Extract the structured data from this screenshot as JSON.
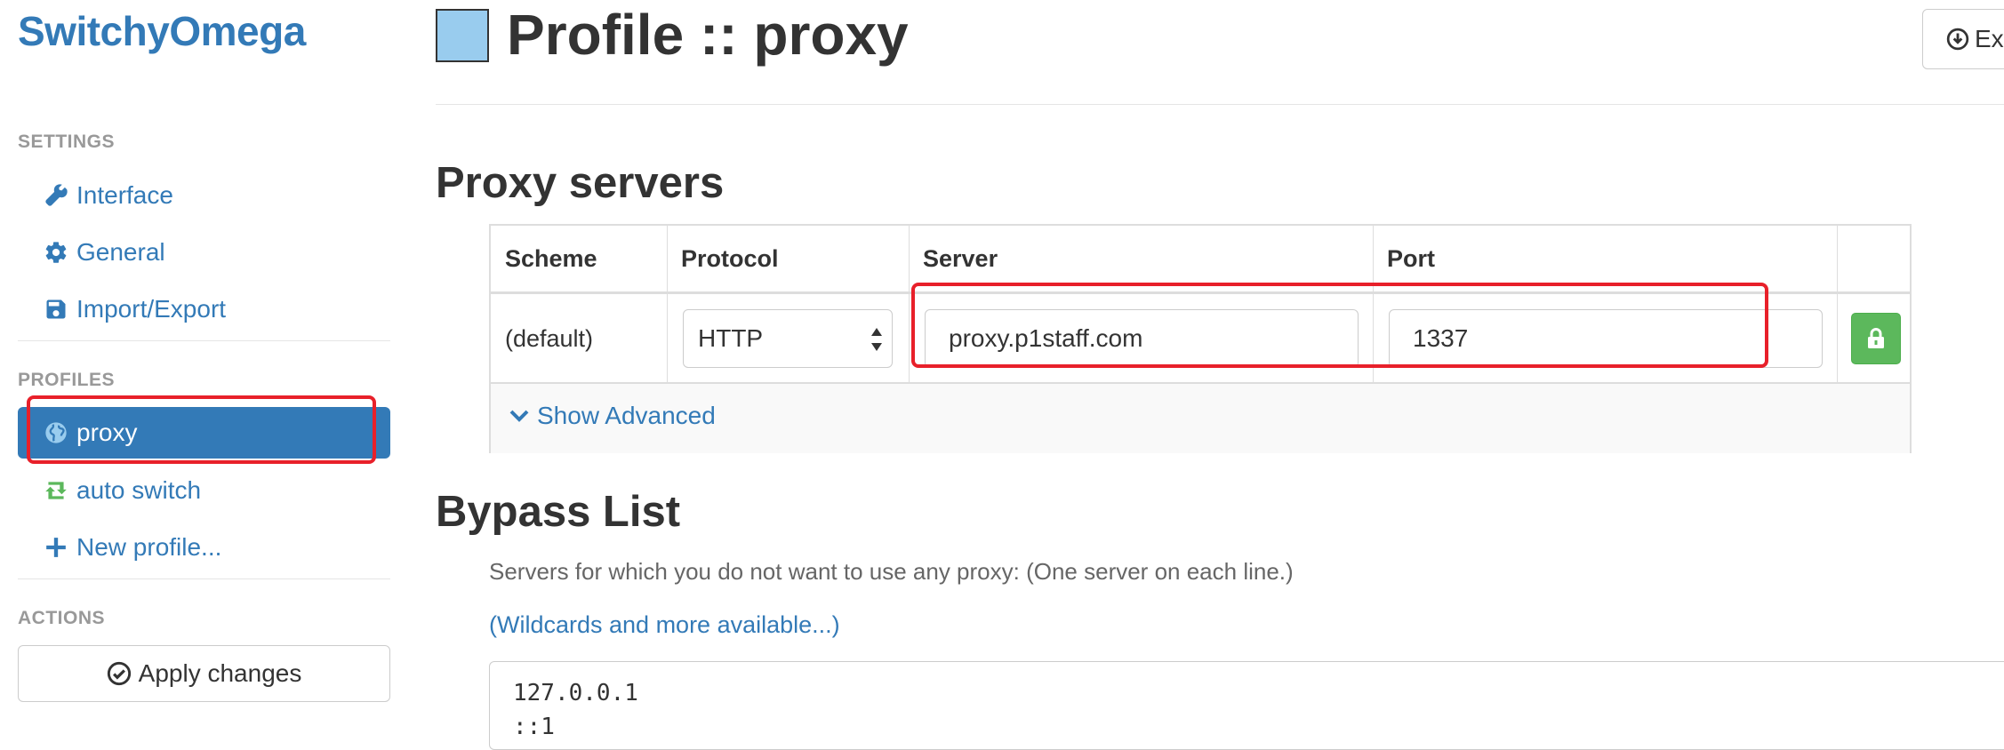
{
  "app": {
    "brand": "SwitchyOmega"
  },
  "sidebar": {
    "settings_header": "SETTINGS",
    "settings_items": [
      {
        "label": "Interface",
        "icon": "wrench-icon"
      },
      {
        "label": "General",
        "icon": "gear-icon"
      },
      {
        "label": "Import/Export",
        "icon": "save-icon"
      }
    ],
    "profiles_header": "PROFILES",
    "profile_items": [
      {
        "label": "proxy",
        "icon": "globe-icon",
        "active": true
      },
      {
        "label": "auto switch",
        "icon": "retweet-icon",
        "active": false
      },
      {
        "label": "New profile...",
        "icon": "plus-icon",
        "active": false
      }
    ],
    "actions_header": "ACTIONS",
    "apply_label": "Apply changes"
  },
  "header": {
    "title": "Profile :: proxy",
    "profile_color": "#99ccee",
    "export_label": "Ex"
  },
  "proxy_servers": {
    "title": "Proxy servers",
    "columns": [
      "Scheme",
      "Protocol",
      "Server",
      "Port"
    ],
    "rows": [
      {
        "scheme": "(default)",
        "protocol": "HTTP",
        "server": "proxy.p1staff.com",
        "port": "1337"
      }
    ],
    "show_advanced": "Show Advanced"
  },
  "bypass": {
    "title": "Bypass List",
    "help": "Servers for which you do not want to use any proxy: (One server on each line.)",
    "wildcard_link": "(Wildcards and more available...)",
    "lines": [
      "127.0.0.1",
      "::1"
    ]
  },
  "colors": {
    "brand": "#337ab7",
    "active_bg": "#337ab7",
    "lock_button": "#5cb85c",
    "annotation": "#e8202a"
  }
}
